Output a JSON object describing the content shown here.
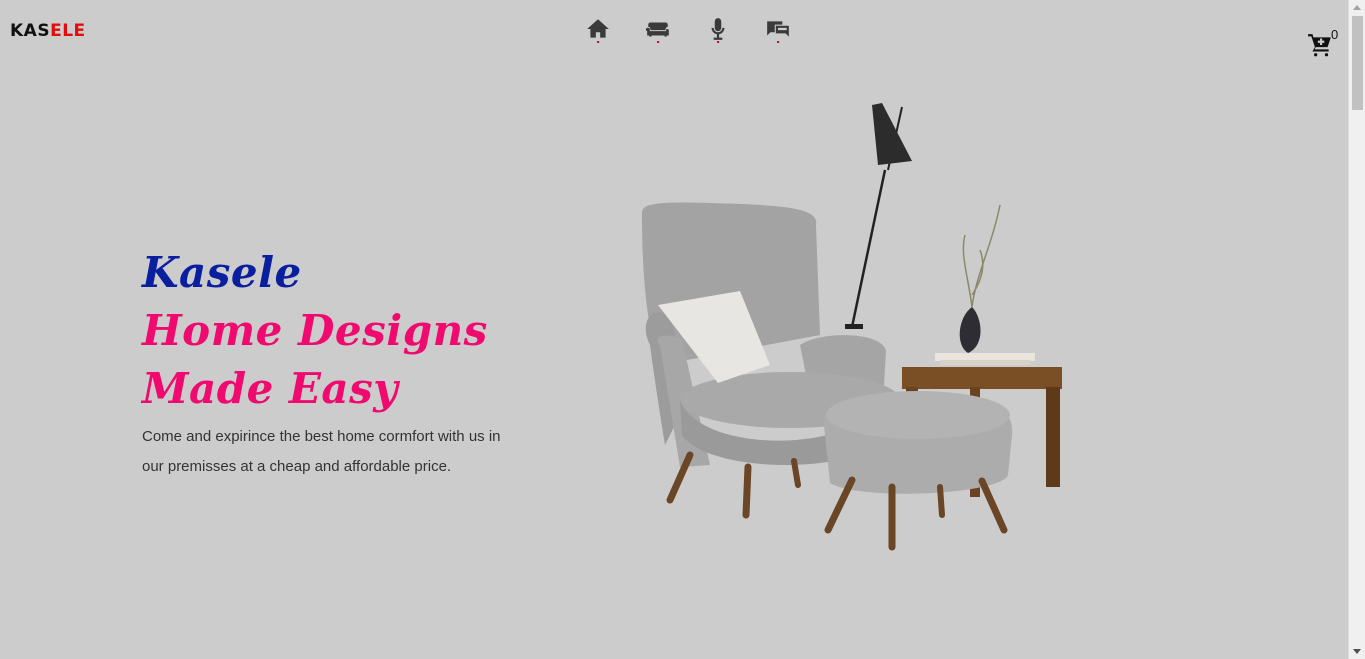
{
  "brand": {
    "part1": "KAS",
    "part2": "ELE"
  },
  "nav": [
    {
      "icon": "home-icon",
      "label": "home"
    },
    {
      "icon": "sofa-icon",
      "label": "furniture"
    },
    {
      "icon": "microphone-icon",
      "label": "voice"
    },
    {
      "icon": "contact-icon",
      "label": "contact"
    }
  ],
  "cart": {
    "count": "0"
  },
  "hero": {
    "line1": "Kasele",
    "line2": "Home Designs",
    "line3": "Made Easy",
    "description": "Come and expirince the best home cormfort with us in our premisses at a cheap and affordable price."
  },
  "colors": {
    "background": "#cccccc",
    "brand_dark": "#111111",
    "brand_red": "#e30b0b",
    "heading_blue": "#0a1ea0",
    "heading_pink": "#f0096e"
  }
}
